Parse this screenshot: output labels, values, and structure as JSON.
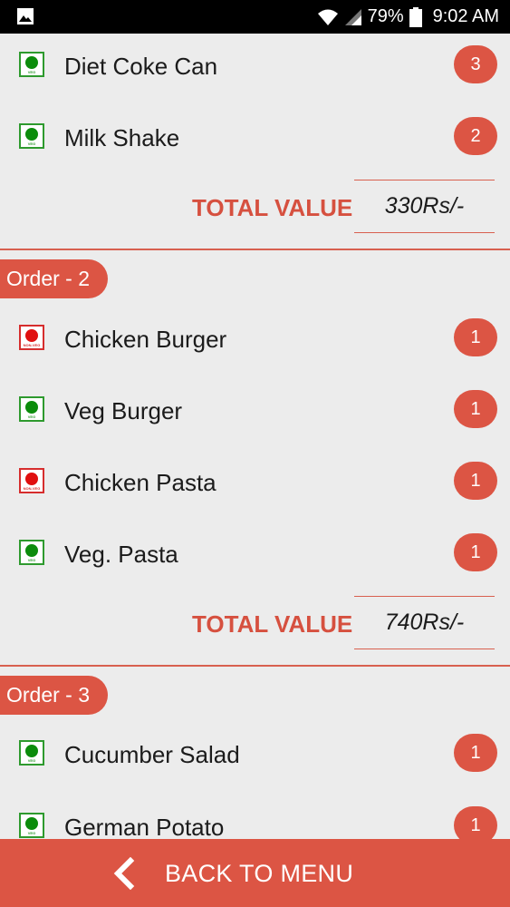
{
  "status_bar": {
    "battery": "79%",
    "time": "9:02 AM"
  },
  "orders_top": {
    "items": [
      {
        "name": "Diet Coke Can",
        "qty": "3",
        "type": "veg"
      },
      {
        "name": "Milk Shake",
        "qty": "2",
        "type": "veg"
      }
    ],
    "total_label": "TOTAL VALUE",
    "total_value": "330Rs/-"
  },
  "order2": {
    "label": "Order - 2",
    "items": [
      {
        "name": "Chicken Burger",
        "qty": "1",
        "type": "non-veg"
      },
      {
        "name": "Veg Burger",
        "qty": "1",
        "type": "veg"
      },
      {
        "name": "Chicken Pasta",
        "qty": "1",
        "type": "non-veg"
      },
      {
        "name": "Veg. Pasta",
        "qty": "1",
        "type": "veg"
      }
    ],
    "total_label": "TOTAL VALUE",
    "total_value": "740Rs/-"
  },
  "order3": {
    "label": "Order - 3",
    "items": [
      {
        "name": "Cucumber Salad",
        "qty": "1",
        "type": "veg"
      },
      {
        "name": "German Potato",
        "qty": "1",
        "type": "veg"
      }
    ]
  },
  "badges": {
    "veg_text": "VEG",
    "nonveg_text": "NON-VEG"
  },
  "footer": {
    "back_label": "BACK TO MENU"
  },
  "colors": {
    "accent": "#dc5544",
    "veg": "#0c8c0c",
    "nonveg": "#e01010",
    "background": "#ececec"
  }
}
